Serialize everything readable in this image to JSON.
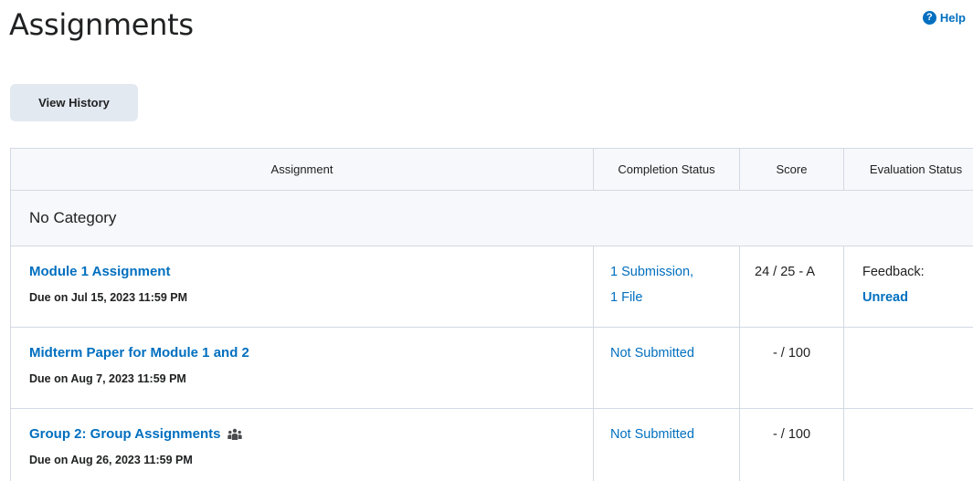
{
  "page": {
    "title": "Assignments",
    "help_label": "Help",
    "help_icon": "question-circle-icon",
    "view_history_label": "View History"
  },
  "colors": {
    "link": "#006fbf",
    "header_bg": "#f6f8fb",
    "border": "#d3d9e3",
    "button_bg": "#e3e9f1"
  },
  "table": {
    "headers": {
      "assignment": "Assignment",
      "completion_status": "Completion Status",
      "score": "Score",
      "evaluation_status": "Evaluation Status"
    },
    "category": "No Category",
    "rows": [
      {
        "name": "Module 1 Assignment",
        "due": "Due on Jul 15, 2023 11:59 PM",
        "completion": "1 Submission, 1 File",
        "score": "24 / 25 - A",
        "evaluation_label": "Feedback:",
        "evaluation_link": "Unread"
      },
      {
        "name": "Midterm Paper for Module 1 and 2",
        "due": "Due on Aug 7, 2023 11:59 PM",
        "completion": "Not Submitted",
        "score": "- / 100",
        "evaluation_label": "",
        "evaluation_link": ""
      },
      {
        "name": "Group 2: Group Assignments",
        "name_icon": "group-icon",
        "due": "Due on Aug 26, 2023 11:59 PM",
        "completion": "Not Submitted",
        "score": "- / 100",
        "evaluation_label": "",
        "evaluation_link": ""
      }
    ]
  }
}
